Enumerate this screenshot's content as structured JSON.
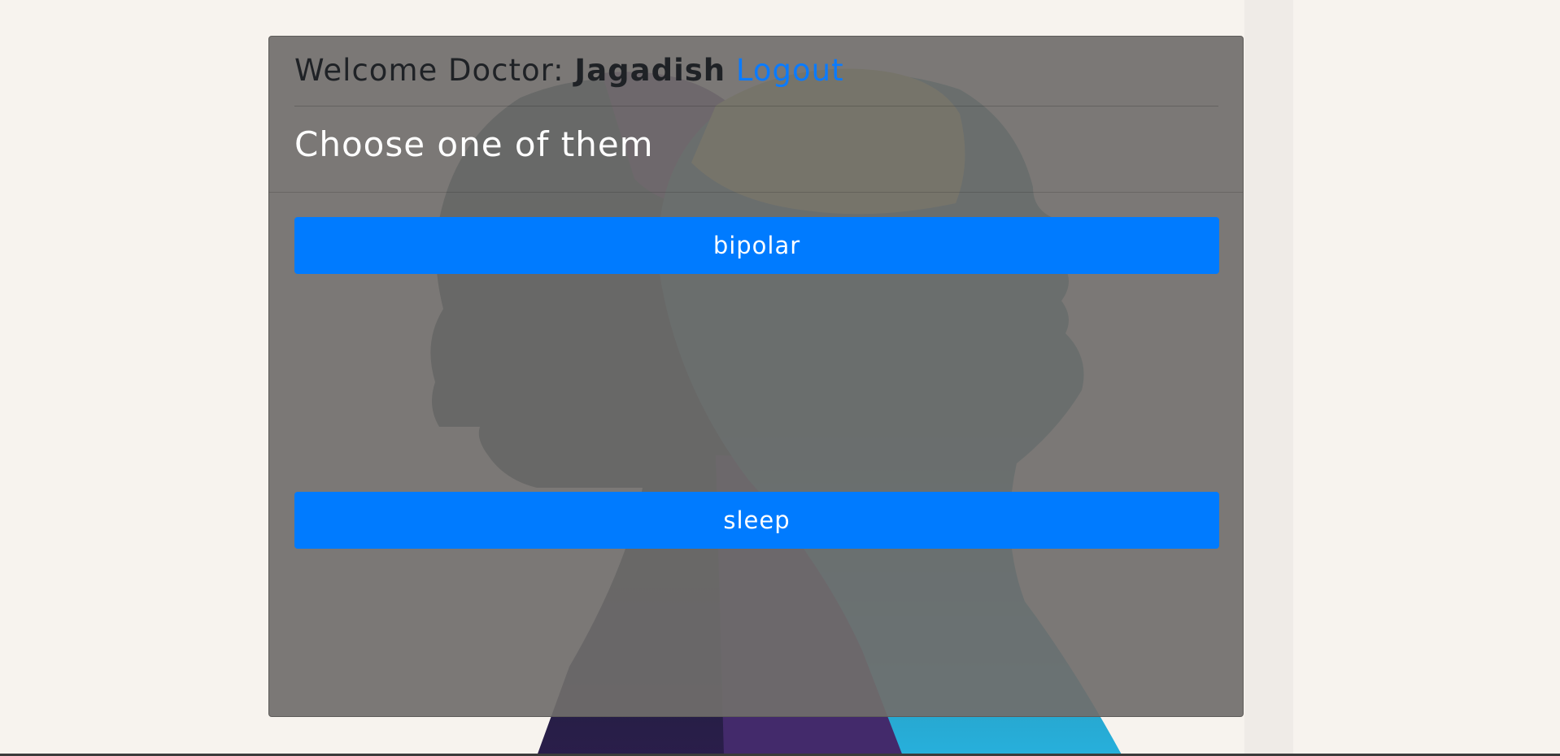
{
  "header": {
    "welcome_prefix": "Welcome Doctor: ",
    "doctor_name": "Jagadish",
    "logout_label": "Logout"
  },
  "main": {
    "title": "Choose one of them",
    "choices": [
      {
        "label": "bipolar"
      },
      {
        "label": "sleep"
      }
    ]
  },
  "colors": {
    "accent": "#007bff",
    "card_overlay": "#706e6b",
    "page_background": "#f7f3ee"
  }
}
